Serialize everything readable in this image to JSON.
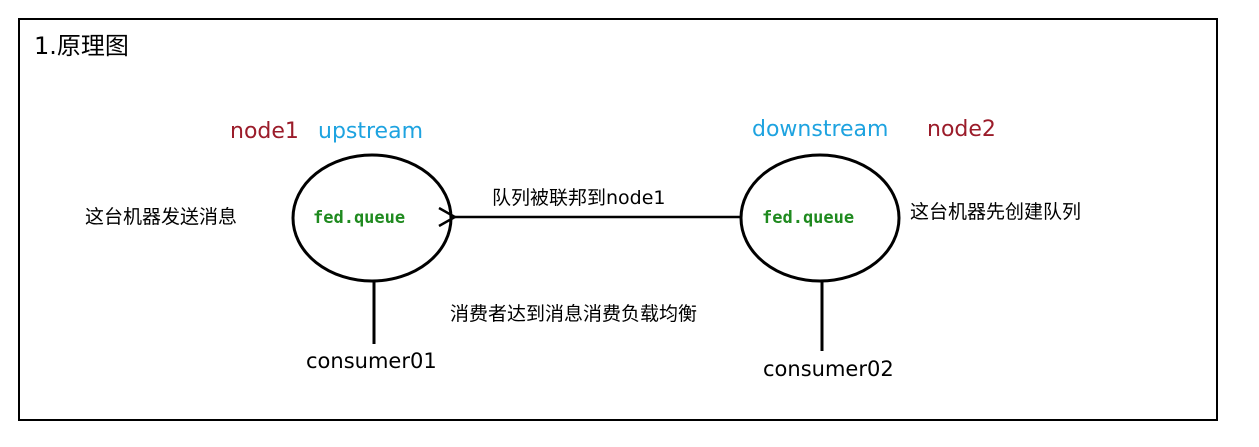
{
  "title": "1.原理图",
  "colors": {
    "node_name": "#9b1c2a",
    "role": "#1ea3e0",
    "queue": "#1f8a1f",
    "line": "#000000"
  },
  "left": {
    "node": "node1",
    "role": "upstream",
    "description": "这台机器发送消息",
    "queue": "fed.queue",
    "consumer": "consumer01"
  },
  "right": {
    "node": "node2",
    "role": "downstream",
    "description": "这台机器先创建队列",
    "queue": "fed.queue",
    "consumer": "consumer02"
  },
  "arrow_label": "队列被联邦到node1",
  "note": "消费者达到消息消费负载均衡"
}
